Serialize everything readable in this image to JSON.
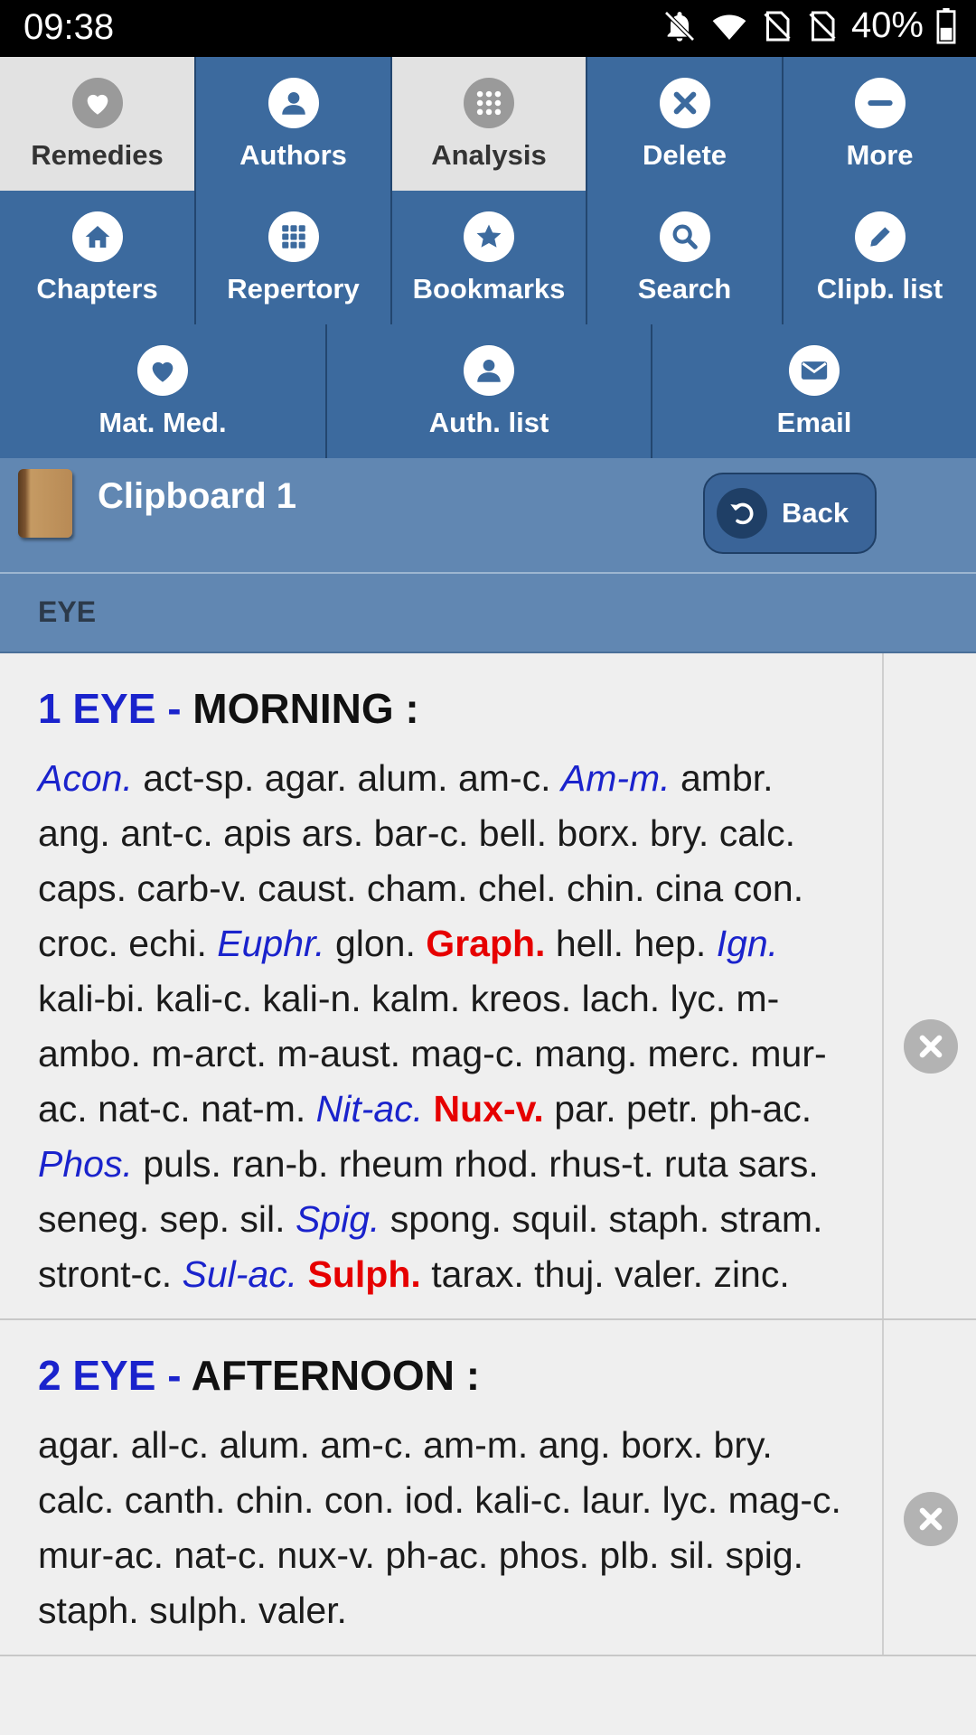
{
  "status_bar": {
    "time": "09:38",
    "battery": "40%"
  },
  "toolbar": {
    "row1": [
      {
        "label": "Remedies",
        "icon": "heart-icon",
        "active": true
      },
      {
        "label": "Authors",
        "icon": "person-icon",
        "active": false
      },
      {
        "label": "Analysis",
        "icon": "grid-icon",
        "active": true
      },
      {
        "label": "Delete",
        "icon": "close-icon",
        "active": false
      },
      {
        "label": "More",
        "icon": "minus-icon",
        "active": false
      }
    ],
    "row2": [
      {
        "label": "Chapters",
        "icon": "home-icon"
      },
      {
        "label": "Repertory",
        "icon": "grid-icon"
      },
      {
        "label": "Bookmarks",
        "icon": "star-icon"
      },
      {
        "label": "Search",
        "icon": "search-icon"
      },
      {
        "label": "Clipb. list",
        "icon": "pencil-icon"
      }
    ],
    "row3": [
      {
        "label": "Mat. Med.",
        "icon": "heart-icon"
      },
      {
        "label": "Auth. list",
        "icon": "person-icon"
      },
      {
        "label": "Email",
        "icon": "envelope-icon"
      }
    ]
  },
  "clipboard": {
    "title": "Clipboard 1",
    "back_label": "Back"
  },
  "section": {
    "title": "EYE"
  },
  "rubrics": [
    {
      "number": "1 EYE -",
      "title": "MORNING :",
      "remedies": [
        {
          "t": "Acon.",
          "g": 2
        },
        {
          "t": "act-sp.",
          "g": 1
        },
        {
          "t": "agar.",
          "g": 1
        },
        {
          "t": "alum.",
          "g": 1
        },
        {
          "t": "am-c.",
          "g": 1
        },
        {
          "t": "Am-m.",
          "g": 2
        },
        {
          "t": "ambr.",
          "g": 1
        },
        {
          "t": "ang.",
          "g": 1
        },
        {
          "t": "ant-c.",
          "g": 1
        },
        {
          "t": "apis",
          "g": 1
        },
        {
          "t": "ars.",
          "g": 1
        },
        {
          "t": "bar-c.",
          "g": 1
        },
        {
          "t": "bell.",
          "g": 1
        },
        {
          "t": "borx.",
          "g": 1
        },
        {
          "t": "bry.",
          "g": 1
        },
        {
          "t": "calc.",
          "g": 1
        },
        {
          "t": "caps.",
          "g": 1
        },
        {
          "t": "carb-v.",
          "g": 1
        },
        {
          "t": "caust.",
          "g": 1
        },
        {
          "t": "cham.",
          "g": 1
        },
        {
          "t": "chel.",
          "g": 1
        },
        {
          "t": "chin.",
          "g": 1
        },
        {
          "t": "cina",
          "g": 1
        },
        {
          "t": "con.",
          "g": 1
        },
        {
          "t": "croc.",
          "g": 1
        },
        {
          "t": "echi.",
          "g": 1
        },
        {
          "t": "Euphr.",
          "g": 2
        },
        {
          "t": "glon.",
          "g": 1
        },
        {
          "t": "Graph.",
          "g": 3
        },
        {
          "t": "hell.",
          "g": 1
        },
        {
          "t": "hep.",
          "g": 1
        },
        {
          "t": "Ign.",
          "g": 2
        },
        {
          "t": "kali-bi.",
          "g": 1
        },
        {
          "t": "kali-c.",
          "g": 1
        },
        {
          "t": "kali-n.",
          "g": 1
        },
        {
          "t": "kalm.",
          "g": 1
        },
        {
          "t": "kreos.",
          "g": 1
        },
        {
          "t": "lach.",
          "g": 1
        },
        {
          "t": "lyc.",
          "g": 1
        },
        {
          "t": "m-ambo.",
          "g": 1
        },
        {
          "t": "m-arct.",
          "g": 1
        },
        {
          "t": "m-aust.",
          "g": 1
        },
        {
          "t": "mag-c.",
          "g": 1
        },
        {
          "t": "mang.",
          "g": 1
        },
        {
          "t": "merc.",
          "g": 1
        },
        {
          "t": "mur-ac.",
          "g": 1
        },
        {
          "t": "nat-c.",
          "g": 1
        },
        {
          "t": "nat-m.",
          "g": 1
        },
        {
          "t": "Nit-ac.",
          "g": 2
        },
        {
          "t": "Nux-v.",
          "g": 3
        },
        {
          "t": "par.",
          "g": 1
        },
        {
          "t": "petr.",
          "g": 1
        },
        {
          "t": "ph-ac.",
          "g": 1
        },
        {
          "t": "Phos.",
          "g": 2
        },
        {
          "t": "puls.",
          "g": 1
        },
        {
          "t": "ran-b.",
          "g": 1
        },
        {
          "t": "rheum",
          "g": 1
        },
        {
          "t": "rhod.",
          "g": 1
        },
        {
          "t": "rhus-t.",
          "g": 1
        },
        {
          "t": "ruta",
          "g": 1
        },
        {
          "t": "sars.",
          "g": 1
        },
        {
          "t": "seneg.",
          "g": 1
        },
        {
          "t": "sep.",
          "g": 1
        },
        {
          "t": "sil.",
          "g": 1
        },
        {
          "t": "Spig.",
          "g": 2
        },
        {
          "t": "spong.",
          "g": 1
        },
        {
          "t": "squil.",
          "g": 1
        },
        {
          "t": "staph.",
          "g": 1
        },
        {
          "t": "stram.",
          "g": 1
        },
        {
          "t": "stront-c.",
          "g": 1
        },
        {
          "t": "Sul-ac.",
          "g": 2
        },
        {
          "t": "Sulph.",
          "g": 3
        },
        {
          "t": "tarax.",
          "g": 1
        },
        {
          "t": "thuj.",
          "g": 1
        },
        {
          "t": "valer.",
          "g": 1
        },
        {
          "t": "zinc.",
          "g": 1
        }
      ]
    },
    {
      "number": "2 EYE -",
      "title": "AFTERNOON :",
      "remedies": [
        {
          "t": "agar.",
          "g": 1
        },
        {
          "t": "all-c.",
          "g": 1
        },
        {
          "t": "alum.",
          "g": 1
        },
        {
          "t": "am-c.",
          "g": 1
        },
        {
          "t": "am-m.",
          "g": 1
        },
        {
          "t": "ang.",
          "g": 1
        },
        {
          "t": "borx.",
          "g": 1
        },
        {
          "t": "bry.",
          "g": 1
        },
        {
          "t": "calc.",
          "g": 1
        },
        {
          "t": "canth.",
          "g": 1
        },
        {
          "t": "chin.",
          "g": 1
        },
        {
          "t": "con.",
          "g": 1
        },
        {
          "t": "iod.",
          "g": 1
        },
        {
          "t": "kali-c.",
          "g": 1
        },
        {
          "t": "laur.",
          "g": 1
        },
        {
          "t": "lyc.",
          "g": 1
        },
        {
          "t": "mag-c.",
          "g": 1
        },
        {
          "t": "mur-ac.",
          "g": 1
        },
        {
          "t": "nat-c.",
          "g": 1
        },
        {
          "t": "nux-v.",
          "g": 1
        },
        {
          "t": "ph-ac.",
          "g": 1
        },
        {
          "t": "phos.",
          "g": 1
        },
        {
          "t": "plb.",
          "g": 1
        },
        {
          "t": "sil.",
          "g": 1
        },
        {
          "t": "spig.",
          "g": 1
        },
        {
          "t": "staph.",
          "g": 1
        },
        {
          "t": "sulph.",
          "g": 1
        },
        {
          "t": "valer.",
          "g": 1
        }
      ]
    }
  ]
}
